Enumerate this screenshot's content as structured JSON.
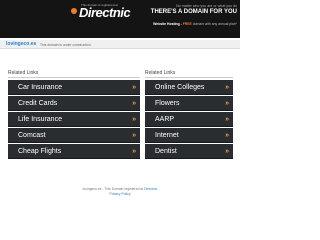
{
  "header": {
    "brand_tag": "This domain is registered at",
    "brand_name": "Directnic",
    "promo_top": "No matter who you are or what you do",
    "promo_main": "THERE'S A DOMAIN FOR YOU",
    "promo_sub_prefix": "Website Hosting -",
    "promo_sub_price": "FREE",
    "promo_sub_suffix": "domain with any annual plan*"
  },
  "domain_bar": {
    "domain": "lovingeco.es",
    "note": "This domain is under construction"
  },
  "left_column": {
    "title": "Related Links",
    "items": [
      {
        "label": "Car Insurance"
      },
      {
        "label": "Credit Cards"
      },
      {
        "label": "Life Insurance"
      },
      {
        "label": "Comcast"
      },
      {
        "label": "Cheap Flights"
      }
    ]
  },
  "right_column": {
    "title": "Related Links",
    "items": [
      {
        "label": "Online Colleges"
      },
      {
        "label": "Flowers"
      },
      {
        "label": "AARP"
      },
      {
        "label": "Internet"
      },
      {
        "label": "Dentist"
      }
    ]
  },
  "arrow_glyph": "»",
  "footer": {
    "line1_prefix": "lovingeco.es - This Domain registered at",
    "line1_link": "Directnic",
    "privacy_link": "Privacy Policy"
  },
  "colors": {
    "header_bg": "#141414",
    "accent": "#ef7d22",
    "link": "#2f7fc1",
    "item_bg": "#292c31",
    "arrow": "#f0a21f"
  }
}
